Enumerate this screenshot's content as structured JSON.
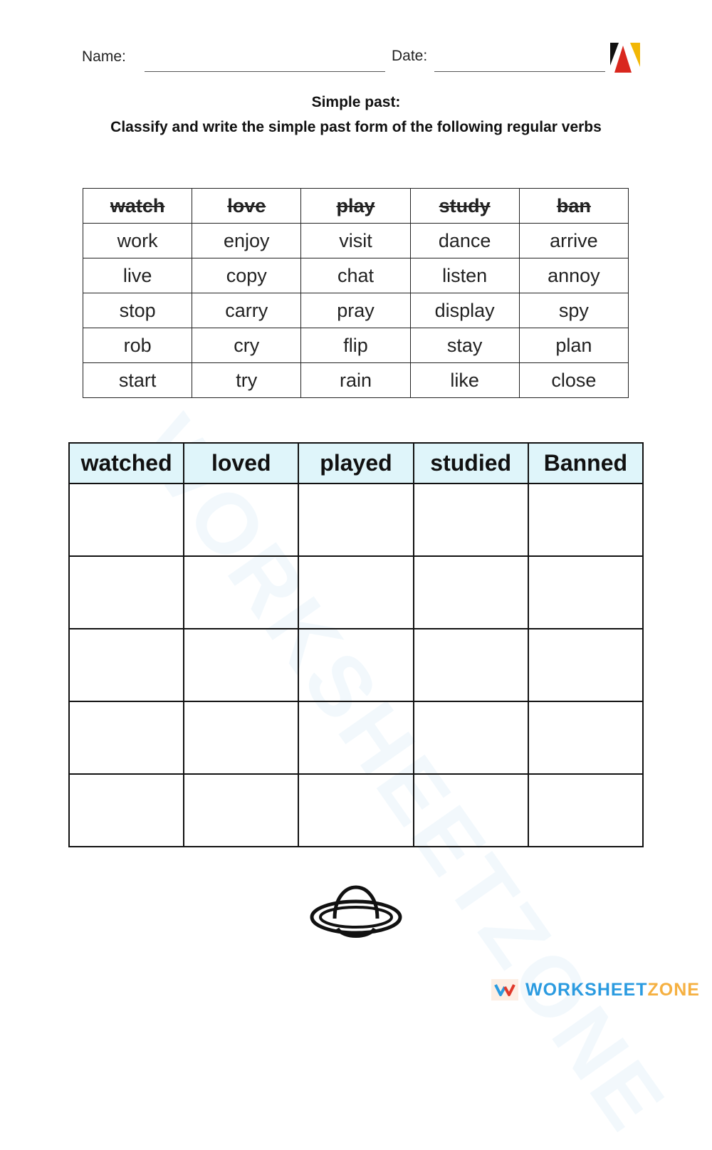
{
  "header": {
    "name_label": "Name:",
    "date_label": "Date:",
    "logo_icon": "brand-triangle-logo-icon"
  },
  "instructions": {
    "title": "Simple past:",
    "subtitle": "Classify and write the simple past form of the following regular verbs"
  },
  "verb_bank": {
    "headers": [
      "watch",
      "love",
      "play",
      "study",
      "ban"
    ],
    "rows": [
      [
        "work",
        "enjoy",
        "visit",
        "dance",
        "arrive"
      ],
      [
        "live",
        "copy",
        "chat",
        "listen",
        "annoy"
      ],
      [
        "stop",
        "carry",
        "pray",
        "display",
        "spy"
      ],
      [
        "rob",
        "cry",
        "flip",
        "stay",
        "plan"
      ],
      [
        "start",
        "try",
        "rain",
        "like",
        "close"
      ]
    ]
  },
  "answer_grid": {
    "headers": [
      "watched",
      "loved",
      "played",
      "studied",
      "Banned"
    ],
    "row_count": 5
  },
  "decoration": {
    "icon": "planet-icon"
  },
  "footer": {
    "brand_part1": "WORKSHEET",
    "brand_part2": "ZONE",
    "colors": {
      "blue": "#2b9be0",
      "orange": "#f5b041",
      "red": "#e0392b"
    }
  },
  "watermark": "WORKSHEETZONE"
}
